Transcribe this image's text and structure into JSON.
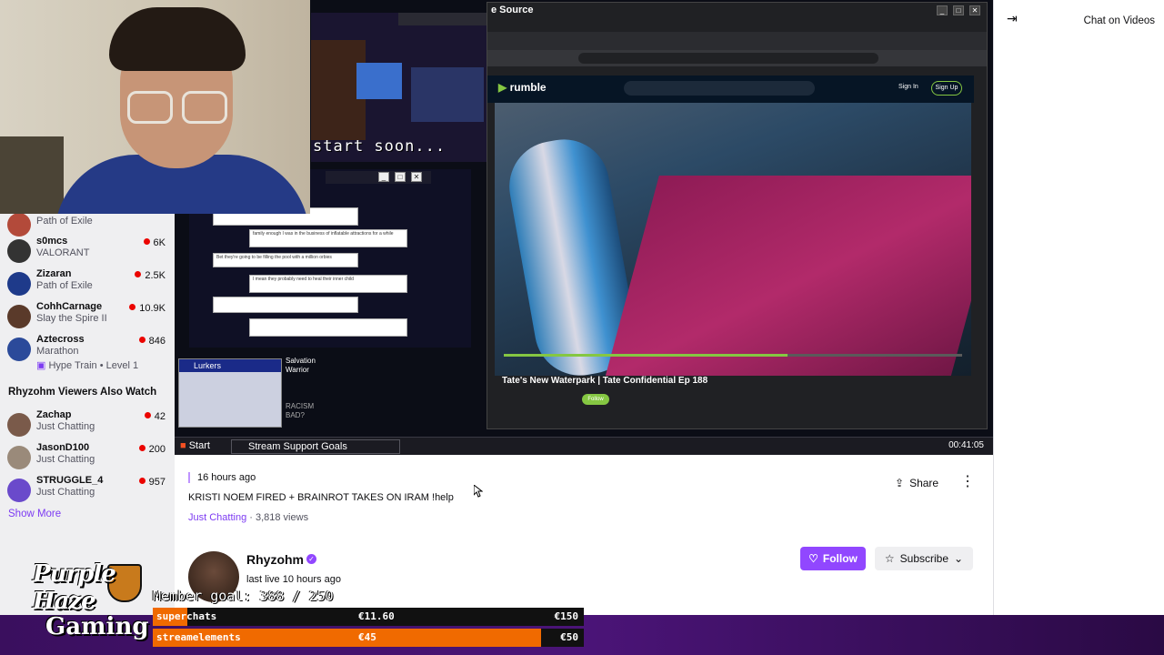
{
  "sidebar": {
    "channels": [
      {
        "name": "",
        "game": "Path of Exile",
        "viewers": "",
        "avatar_color": "#b34a3a"
      },
      {
        "name": "s0mcs",
        "game": "VALORANT",
        "viewers": "6K",
        "avatar_color": "#333333"
      },
      {
        "name": "Zizaran",
        "game": "Path of Exile",
        "viewers": "2.5K",
        "avatar_color": "#1e3a8a"
      },
      {
        "name": "CohhCarnage",
        "game": "Slay the Spire II",
        "viewers": "10.9K",
        "avatar_color": "#5a3a2a"
      },
      {
        "name": "Aztecross",
        "game": "Marathon",
        "viewers": "846",
        "avatar_color": "#2b4a9a",
        "extra": "Hype Train • Level 1"
      }
    ],
    "also_watch_title": "Rhyzohm Viewers Also Watch",
    "also_watch": [
      {
        "name": "Zachap",
        "game": "Just Chatting",
        "viewers": "42",
        "avatar_color": "#7a5a4a"
      },
      {
        "name": "JasonD100",
        "game": "Just Chatting",
        "viewers": "200",
        "avatar_color": "#9a8a7a"
      },
      {
        "name": "STRUGGLE_4",
        "game": "Just Chatting",
        "viewers": "957",
        "avatar_color": "#6a4acb"
      }
    ],
    "show_more": "Show More"
  },
  "video": {
    "browser_title": "e Source",
    "rumble_logo": "rumble",
    "signin": "Sign In",
    "signup": "Sign Up",
    "soon_text": "start soon...",
    "video_title": "Tate's New Waterpark | Tate Confidential Ep 188",
    "follow_small": "Follow",
    "lurkers_title": "Lurkers",
    "salvation_warrior": "Salvation Warrior",
    "racism_bad": "RACISM BAD?",
    "taskbar_start": "Start",
    "taskbar_goals": "Stream Support Goals",
    "taskbar_clock": "00:41:05",
    "progress_fraction": 0.62,
    "chat_bubbles": [
      "family enough I was in the business of inflatable attractions for a while",
      "Bet they're going to be filling the pool with a million orbies",
      "I mean they probably need to heal their inner child",
      "",
      ""
    ]
  },
  "info": {
    "time": "16 hours ago",
    "title": "KRISTI NOEM FIRED + BRAINROT TAKES ON IRAM !help",
    "category": "Just Chatting",
    "views": " · 3,818 views",
    "share": "Share",
    "streamer": "Rhyzohm",
    "last_live": "last live 10 hours ago",
    "follow": "Follow",
    "subscribe": "Subscribe"
  },
  "chat": {
    "label": "Chat on Videos"
  },
  "overlay": {
    "logo_line1": "Purple Haze",
    "logo_line2": "Gaming",
    "member_goal": "Member goal: 388 / 250",
    "goals": [
      {
        "label": "superchats",
        "current": "€11.60",
        "target": "€150",
        "fill_fraction": 0.08,
        "color": "#f06a00"
      },
      {
        "label": "streamelements",
        "current": "€45",
        "target": "€50",
        "fill_fraction": 0.9,
        "color": "#f06a00"
      }
    ]
  },
  "colors": {
    "accent": "#9147ff",
    "link": "#7d3bf2",
    "live_dot": "#eb0400",
    "rumble_green": "#85c742"
  }
}
